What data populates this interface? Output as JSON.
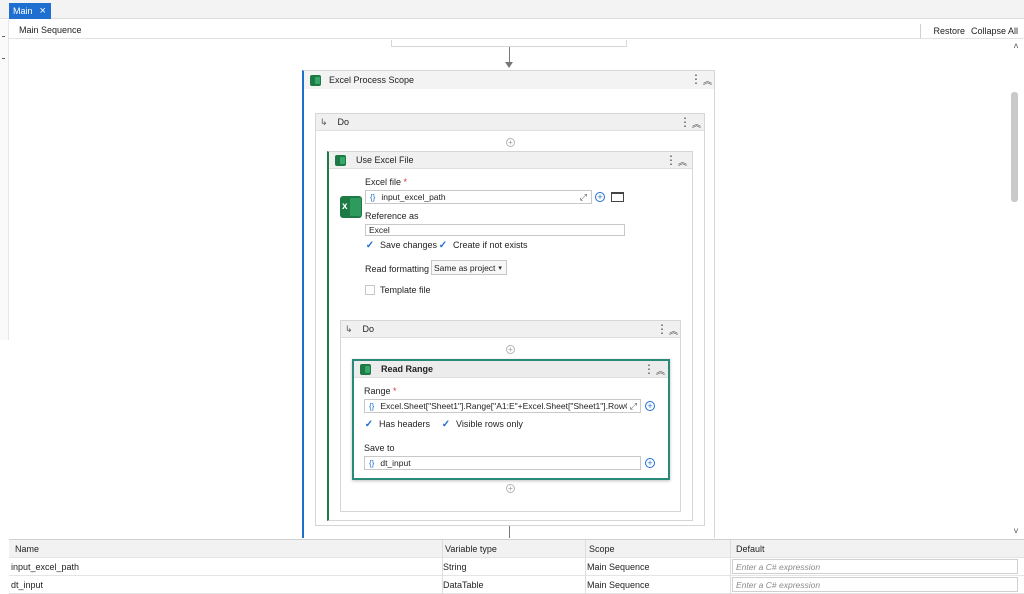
{
  "tabs": [
    {
      "label": "Main",
      "close_icon": "close-icon"
    }
  ],
  "breadcrumb": "Main Sequence",
  "header_actions": {
    "restore": "Restore",
    "collapse_all": "Collapse All"
  },
  "excel_process_scope": {
    "title": "Excel Process Scope"
  },
  "do_outer": {
    "title": "Do"
  },
  "use_excel_file": {
    "title": "Use Excel File",
    "excel_file_label": "Excel file",
    "required_marker": "*",
    "excel_file_value": "input_excel_path",
    "reference_as_label": "Reference as",
    "reference_as_value": "Excel",
    "save_changes_label": "Save changes",
    "save_changes_checked": true,
    "create_if_not_exists_label": "Create if not exists",
    "create_if_not_exists_checked": true,
    "read_formatting_label": "Read formatting",
    "read_formatting_value": "Same as project",
    "template_file_label": "Template file",
    "template_file_checked": false
  },
  "do_inner": {
    "title": "Do"
  },
  "read_range": {
    "title": "Read Range",
    "range_label": "Range",
    "required_marker": "*",
    "range_value": "Excel.Sheet[\"Sheet1\"].Range[\"A1:E\"+Excel.Sheet[\"Sheet1\"].RowC",
    "has_headers_label": "Has headers",
    "has_headers_checked": true,
    "visible_rows_only_label": "Visible rows only",
    "visible_rows_only_checked": true,
    "save_to_label": "Save to",
    "save_to_value": "dt_input"
  },
  "brace_glyph": "{}",
  "variables": {
    "columns": [
      "Name",
      "Variable type",
      "Scope",
      "Default"
    ],
    "rows": [
      {
        "name": "input_excel_path",
        "type": "String",
        "scope": "Main Sequence",
        "default_placeholder": "Enter a C# expression"
      },
      {
        "name": "dt_input",
        "type": "DataTable",
        "scope": "Main Sequence",
        "default_placeholder": "Enter a C# expression"
      }
    ]
  },
  "colors": {
    "accent": "#1f6fd1",
    "excel_green": "#1d7a45",
    "selected_border": "#2a8a7a"
  }
}
